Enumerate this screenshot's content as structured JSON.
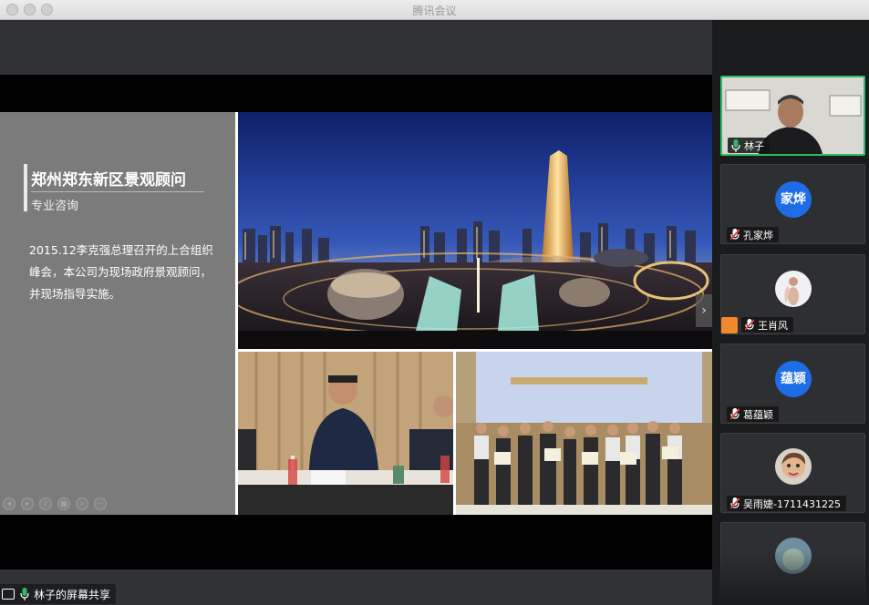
{
  "window": {
    "title": "腾讯会议"
  },
  "slide": {
    "title": "郑州郑东新区景观顾问",
    "subtitle": "专业咨询",
    "body": "2015.12李克强总理召开的上合组织峰会，本公司为现场政府景观顾问，并现场指导实施。"
  },
  "share": {
    "label": "林子的屏幕共享"
  },
  "participants": [
    {
      "name": "林子",
      "avatar_type": "video",
      "mic": "on",
      "active": true
    },
    {
      "name": "孔家烨",
      "avatar_text": "家烨",
      "avatar_type": "initials",
      "mic": "muted"
    },
    {
      "name": "王肖风",
      "avatar_type": "photo",
      "mic": "muted"
    },
    {
      "name": "葛蕴颖",
      "avatar_text": "蕴颖",
      "avatar_type": "initials",
      "mic": "muted"
    },
    {
      "name": "吴雨婕-1711431225",
      "avatar_type": "photo",
      "mic": "muted"
    }
  ],
  "colors": {
    "accent_green": "#2dbb67",
    "avatar_blue": "#1f6de6",
    "mic_red": "#e64040"
  }
}
